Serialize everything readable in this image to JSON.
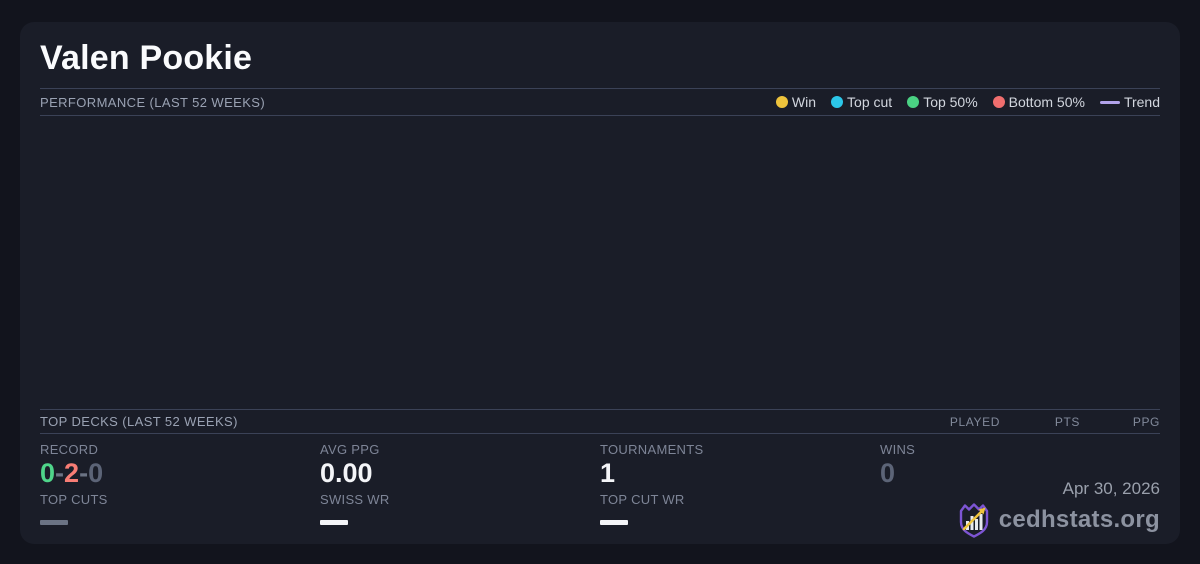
{
  "page": {
    "title": "Valen Pookie"
  },
  "performance": {
    "heading": "PERFORMANCE (LAST 52 WEEKS)",
    "legend": [
      {
        "label": "Win",
        "color": "#eec33c",
        "marker": "dot"
      },
      {
        "label": "Top cut",
        "color": "#2cc7e9",
        "marker": "dot"
      },
      {
        "label": "Top 50%",
        "color": "#4ad283",
        "marker": "dot"
      },
      {
        "label": "Bottom 50%",
        "color": "#f06e6e",
        "marker": "dot"
      },
      {
        "label": "Trend",
        "color": "#b2a3ea",
        "marker": "line"
      }
    ],
    "chart_empty": true
  },
  "top_decks": {
    "heading": "TOP DECKS (LAST 52 WEEKS)",
    "columns": [
      "PLAYED",
      "PTS",
      "PPG"
    ],
    "rows": []
  },
  "stats": {
    "record": {
      "label": "RECORD",
      "wins": "0",
      "losses": "2",
      "draws": "0",
      "separator": "-"
    },
    "avg_ppg": {
      "label": "AVG PPG",
      "value": "0.00"
    },
    "tournaments": {
      "label": "TOURNAMENTS",
      "value": "1"
    },
    "wins": {
      "label": "WINS",
      "value": "0"
    },
    "top_cuts": {
      "label": "TOP CUTS",
      "placeholder": "—"
    },
    "swiss_wr": {
      "label": "SWISS WR",
      "placeholder": "—"
    },
    "top_cut_wr": {
      "label": "TOP CUT WR",
      "placeholder": "—"
    }
  },
  "footer": {
    "date": "Apr 30, 2026",
    "brand": "cedhstats.org"
  },
  "colors": {
    "page_background": "#12141d",
    "card_background": "#1a1d28",
    "divider": "#3b4257",
    "record_win": "#4fd58a",
    "record_loss": "#f87d75",
    "record_draw": "#5c6477",
    "logo_purple": "#7d55d4",
    "logo_gold": "#eec33c"
  }
}
